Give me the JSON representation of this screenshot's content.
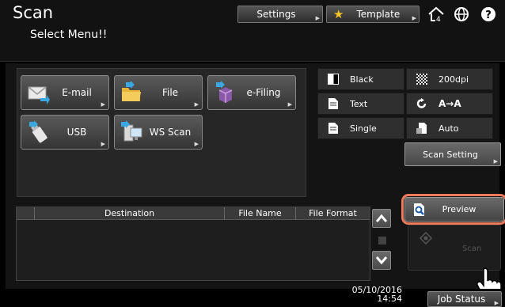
{
  "header": {
    "title": "Scan",
    "subtitle": "Select Menu!!",
    "settings_label": "Settings",
    "template_label": "Template",
    "icons": [
      "home-icon",
      "globe-icon",
      "help-icon"
    ]
  },
  "functions": [
    {
      "name": "email",
      "label": "E-mail",
      "icon": "envelope-icon"
    },
    {
      "name": "file",
      "label": "File",
      "icon": "folder-icon"
    },
    {
      "name": "efiling",
      "label": "e-Filing",
      "icon": "box-icon"
    },
    {
      "name": "usb",
      "label": "USB",
      "icon": "usb-icon"
    },
    {
      "name": "wsscan",
      "label": "WS Scan",
      "icon": "computer-icon"
    }
  ],
  "scan_settings": {
    "color_mode": "Black",
    "resolution": "200dpi",
    "original_mode": "Text",
    "rotation_label": "A→A",
    "sides": "Single",
    "original_size": "Auto",
    "scan_setting_label": "Scan Setting"
  },
  "destination_list": {
    "columns": [
      "Destination",
      "File Name",
      "File Format"
    ],
    "rows": []
  },
  "actions": {
    "preview_label": "Preview",
    "scan_label": "Scan"
  },
  "footer": {
    "date": "05/10/2016",
    "time": "14:54",
    "job_status_label": "Job Status"
  },
  "colors": {
    "highlight": "#f07a5c",
    "template_star": "#f7c526"
  }
}
